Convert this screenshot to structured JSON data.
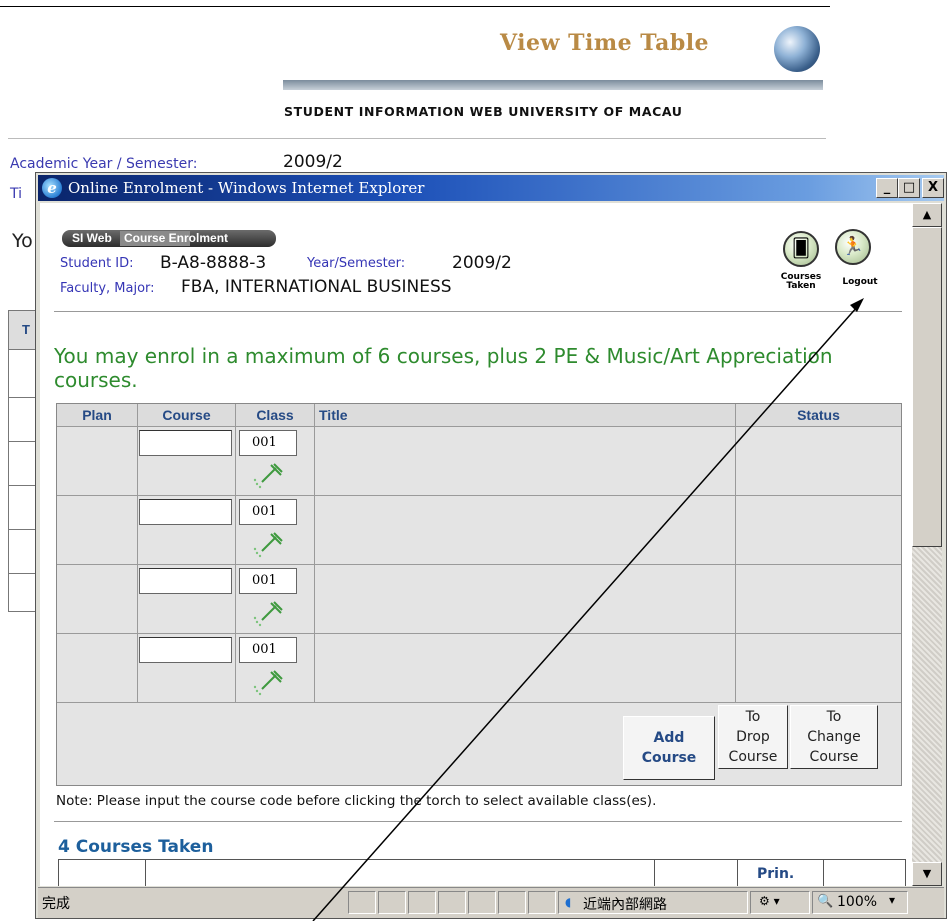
{
  "background_page": {
    "banner_title": "View Time Table",
    "banner_subtitle": "STUDENT INFORMATION WEB   UNIVERSITY OF MACAU",
    "academic_year_label": "Academic Year / Semester:",
    "academic_year_value": "2009/2",
    "time_label": "Ti",
    "you_text": "Yo",
    "table_header": "T"
  },
  "window": {
    "title": "Online Enrolment - Windows Internet Explorer",
    "minimize": "_",
    "maximize": "□",
    "close": "X"
  },
  "header": {
    "si_web": "SI Web",
    "course_enrolment": "Course Enrolment",
    "student_id_label": "Student ID:",
    "student_id_value": "B-A8-8888-3",
    "year_semester_label": "Year/Semester:",
    "year_semester_value": "2009/2",
    "faculty_major_label": "Faculty, Major:",
    "faculty_major_value": "FBA, INTERNATIONAL BUSINESS",
    "courses_taken_caption": "Courses\nTaken",
    "logout_caption": "Logout"
  },
  "message": "You may enrol in a maximum of 6 courses, plus 2 PE & Music/Art Appreciation courses.",
  "enrol_table": {
    "headers": {
      "plan": "Plan",
      "course": "Course",
      "class": "Class",
      "title": "Title",
      "status": "Status"
    },
    "rows": [
      {
        "course": "",
        "class": "001"
      },
      {
        "course": "",
        "class": "001"
      },
      {
        "course": "",
        "class": "001"
      },
      {
        "course": "",
        "class": "001"
      }
    ],
    "buttons": {
      "add": "Add\nCourse",
      "drop": "To\nDrop\nCourse",
      "change": "To\nChange\nCourse"
    }
  },
  "note": "Note: Please input the course code before clicking the torch to select available class(es).",
  "courses_taken": {
    "title": "4 Courses Taken",
    "prin_header": "Prin."
  },
  "statusbar": {
    "status_text": "完成",
    "zone_text": "近端內部網路",
    "zoom_text": "100%"
  }
}
